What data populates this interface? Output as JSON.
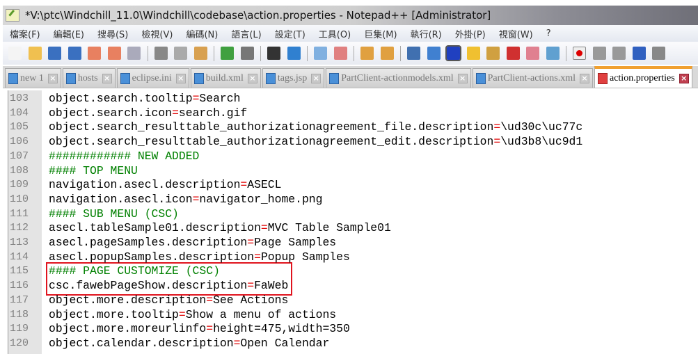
{
  "window": {
    "title": "*V:\\ptc\\Windchill_11.0\\Windchill\\codebase\\action.properties - Notepad++ [Administrator]"
  },
  "menu": [
    "檔案(F)",
    "編輯(E)",
    "搜尋(S)",
    "檢視(V)",
    "編碼(N)",
    "語言(L)",
    "設定(T)",
    "工具(O)",
    "巨集(M)",
    "執行(R)",
    "外掛(P)",
    "視窗(W)",
    "?"
  ],
  "toolbar_icons": [
    "new-file",
    "open-file",
    "save",
    "save-all",
    "close",
    "close-all",
    "print",
    "|",
    "cut",
    "copy",
    "paste",
    "|",
    "undo",
    "redo",
    "|",
    "find",
    "replace",
    "|",
    "zoom-in",
    "zoom-out",
    "|",
    "sync-vertical",
    "sync-horizontal",
    "|",
    "word-wrap",
    "show-all-chars",
    "indent-guide",
    "user-language",
    "doc-map",
    "function-list",
    "folder-as-workspace",
    "monitor",
    "|",
    "record-macro",
    "stop-record",
    "play-macro",
    "run-macro-multiple",
    "save-macro"
  ],
  "tabs": [
    {
      "label": "new 1",
      "active": false
    },
    {
      "label": "hosts",
      "active": false
    },
    {
      "label": "eclipse.ini",
      "active": false
    },
    {
      "label": "build.xml",
      "active": false
    },
    {
      "label": "tags.jsp",
      "active": false
    },
    {
      "label": "PartClient-actionmodels.xml",
      "active": false
    },
    {
      "label": "PartClient-actions.xml",
      "active": false
    },
    {
      "label": "action.properties",
      "active": true
    }
  ],
  "lines": [
    {
      "n": "103",
      "key": "object.search.tooltip",
      "val": "Search"
    },
    {
      "n": "104",
      "key": "object.search.icon",
      "val": "search.gif"
    },
    {
      "n": "105",
      "key": "object.search_resulttable_authorizationagreement_file.description",
      "val": "\\ud30c\\uc77c"
    },
    {
      "n": "106",
      "key": "object.search_resulttable_authorizationagreement_edit.description",
      "val": "\\ud3b8\\uc9d1"
    },
    {
      "n": "107",
      "comment": "############ NEW ADDED"
    },
    {
      "n": "108",
      "comment": "#### TOP MENU"
    },
    {
      "n": "109",
      "key": "navigation.asecl.description",
      "val": "ASECL"
    },
    {
      "n": "110",
      "key": "navigation.asecl.icon",
      "val": "navigator_home.png"
    },
    {
      "n": "111",
      "comment": "#### SUB MENU (CSC)"
    },
    {
      "n": "112",
      "key": "asecl.tableSample01.description",
      "val": "MVC Table Sample01"
    },
    {
      "n": "113",
      "key": "asecl.pageSamples.description",
      "val": "Page Samples"
    },
    {
      "n": "114",
      "key": "asecl.popupSamples.description",
      "val": "Popup Samples"
    },
    {
      "n": "115",
      "comment": "#### PAGE CUSTOMIZE (CSC)"
    },
    {
      "n": "116",
      "key": "csc.fawebPageShow.description",
      "val": "FaWeb"
    },
    {
      "n": "117",
      "key": "object.more.description",
      "val": "See Actions"
    },
    {
      "n": "118",
      "key": "object.more.tooltip",
      "val": "Show a menu of actions"
    },
    {
      "n": "119",
      "key": "object.more.moreurlinfo",
      "val": "height=475,width=350"
    },
    {
      "n": "120",
      "key": "object.calendar.description",
      "val": "Open Calendar"
    }
  ],
  "highlight": {
    "lines": [
      "115",
      "116"
    ],
    "color": "#e0141e"
  }
}
